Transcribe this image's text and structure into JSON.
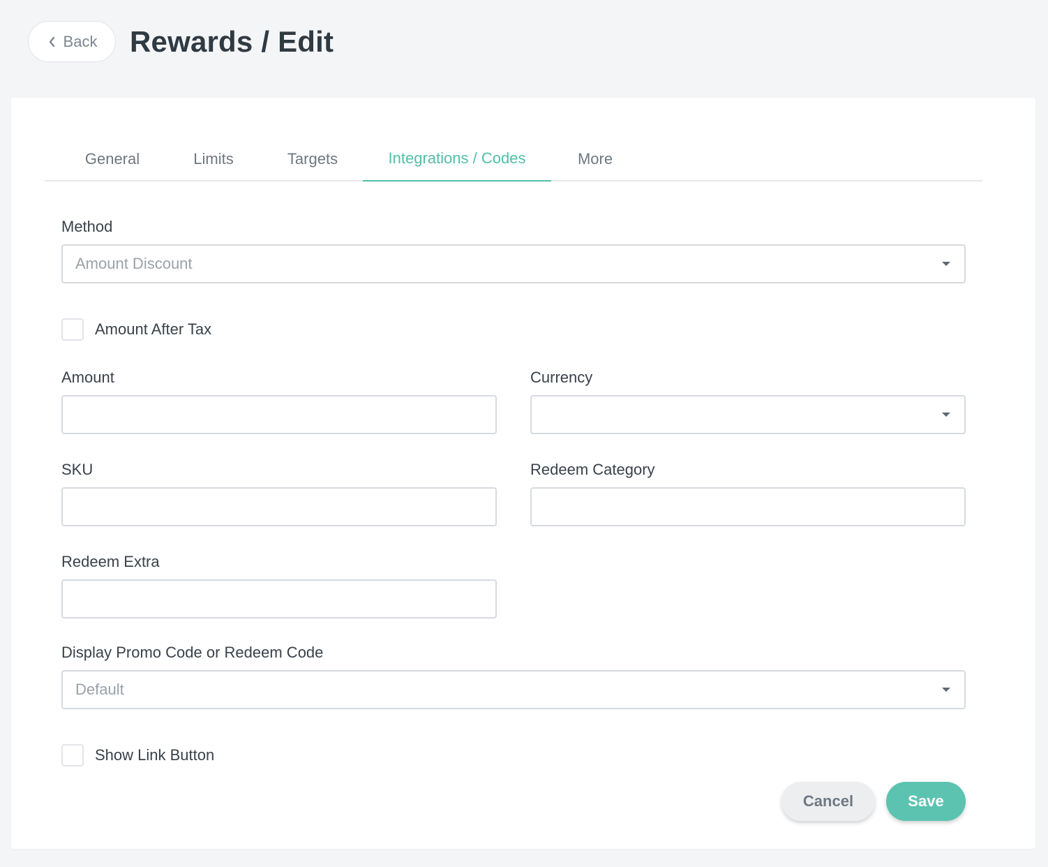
{
  "header": {
    "back_label": "Back",
    "title": "Rewards / Edit"
  },
  "tabs": [
    {
      "label": "General",
      "active": false
    },
    {
      "label": "Limits",
      "active": false
    },
    {
      "label": "Targets",
      "active": false
    },
    {
      "label": "Integrations / Codes",
      "active": true
    },
    {
      "label": "More",
      "active": false
    }
  ],
  "form": {
    "method": {
      "label": "Method",
      "value": "Amount Discount"
    },
    "amount_after_tax": {
      "label": "Amount After Tax",
      "checked": false
    },
    "amount": {
      "label": "Amount",
      "value": ""
    },
    "currency": {
      "label": "Currency",
      "value": ""
    },
    "sku": {
      "label": "SKU",
      "value": ""
    },
    "redeem_category": {
      "label": "Redeem Category",
      "value": ""
    },
    "redeem_extra": {
      "label": "Redeem Extra",
      "value": ""
    },
    "display_code": {
      "label": "Display Promo Code or Redeem Code",
      "value": "Default"
    },
    "show_link_button": {
      "label": "Show Link Button",
      "checked": false
    }
  },
  "actions": {
    "cancel_label": "Cancel",
    "save_label": "Save"
  },
  "colors": {
    "accent": "#4fbfa8",
    "save_button": "#5cc3b1",
    "background": "#f4f5f7"
  }
}
